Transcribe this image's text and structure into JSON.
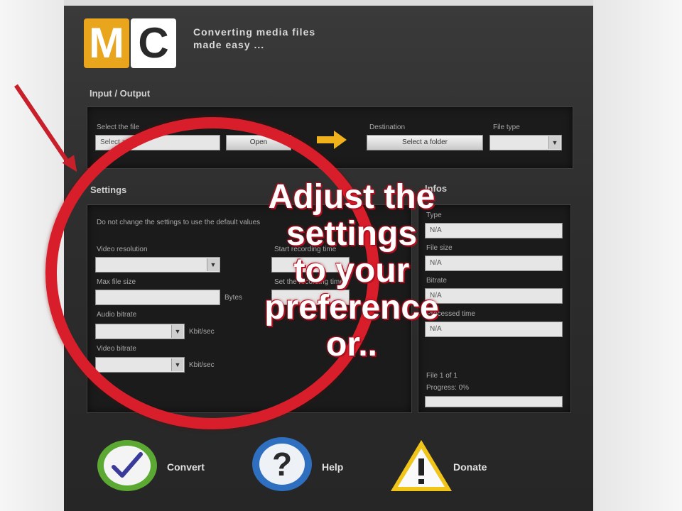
{
  "app": {
    "logo_m": "M",
    "logo_c": "C",
    "tagline_line1": "Converting media files",
    "tagline_line2": "made easy ..."
  },
  "io": {
    "section_label": "Input / Output",
    "select_file_label": "Select the file",
    "select_file_value": "Select a file",
    "open_button": "Open",
    "destination_label": "Destination",
    "select_folder_button": "Select a folder",
    "file_type_label": "File type",
    "file_type_value": ""
  },
  "settings": {
    "section_label": "Settings",
    "hint": "Do not change the settings to use the default values",
    "video_resolution_label": "Video resolution",
    "video_resolution_value": "",
    "max_file_size_label": "Max file size",
    "max_file_size_value": "",
    "max_file_size_unit": "Bytes",
    "audio_bitrate_label": "Audio bitrate",
    "audio_bitrate_value": "",
    "audio_bitrate_unit": "Kbit/sec",
    "video_bitrate_label": "Video bitrate",
    "video_bitrate_value": "",
    "video_bitrate_unit": "Kbit/sec",
    "start_recording_label": "Start recording time",
    "start_recording_value": "",
    "set_recording_label": "Set the recording time",
    "set_recording_value": ""
  },
  "info": {
    "section_label": "Infos",
    "field1_label": "Type",
    "field1_value": "N/A",
    "field2_label": "File size",
    "field2_value": "N/A",
    "field3_label": "Bitrate",
    "field3_value": "N/A",
    "field4_label": "Processed time",
    "field4_value": "N/A",
    "file_counter": "File 1 of 1",
    "progress_text": "Progress: 0%",
    "progress": 0
  },
  "overlay_text": [
    "Adjust the",
    "settings",
    "to your",
    "preference",
    "or.."
  ],
  "actions": {
    "convert_label": "Convert",
    "help_label": "Help",
    "donate_label": "Donate"
  },
  "colors": {
    "accent_orange": "#e9a51c",
    "annotation_red": "#d81e2a",
    "convert_green": "#5ba832",
    "help_blue": "#2f6fc0",
    "donate_yellow": "#f0c419"
  },
  "icons": {
    "convert": "checkmark-icon",
    "help": "question-mark-icon",
    "donate": "warning-triangle-icon",
    "transfer": "arrow-right-icon"
  }
}
